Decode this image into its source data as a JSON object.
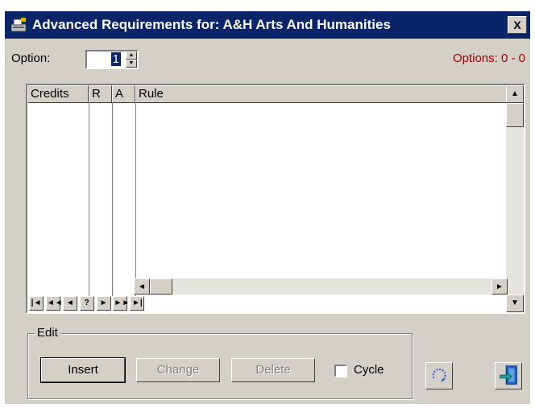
{
  "window": {
    "title": "Advanced Requirements for: A&H Arts  And Humanities",
    "close_glyph": "X"
  },
  "option": {
    "label": "Option:",
    "value": "1",
    "range_text": "Options: 0 - 0"
  },
  "grid": {
    "columns": [
      "Credits",
      "R",
      "A",
      "Rule"
    ],
    "rows": [],
    "nav_buttons": [
      "|◄",
      "◄◄",
      "◄",
      "?",
      "►",
      "►►",
      "►|"
    ]
  },
  "edit": {
    "group_label": "Edit",
    "insert_label": "Insert",
    "change_label": "Change",
    "delete_label": "Delete",
    "cycle_label": "Cycle",
    "cycle_checked": false
  },
  "colors": {
    "title_bar": "#0a246a",
    "range_text": "#a00000",
    "face": "#d4d0c8"
  },
  "icons": [
    "app-icon",
    "close-icon",
    "spin-up-icon",
    "spin-down-icon",
    "scroll-up-icon",
    "scroll-down-icon",
    "scroll-left-icon",
    "scroll-right-icon",
    "refresh-icon",
    "exit-door-icon"
  ]
}
